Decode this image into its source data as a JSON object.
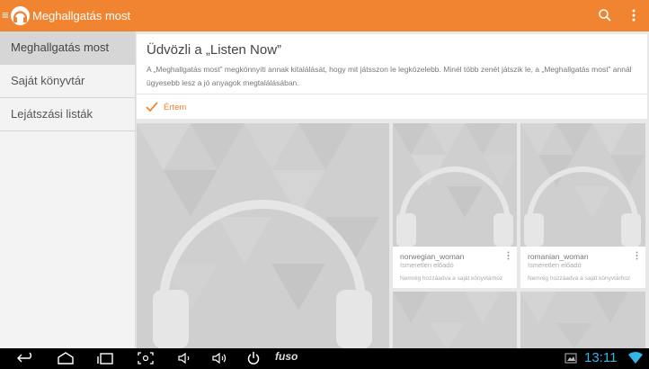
{
  "appbar": {
    "title": "Meghallgatás most"
  },
  "sidebar": {
    "items": [
      {
        "label": "Meghallgatás most",
        "active": true
      },
      {
        "label": "Saját könyvtár",
        "active": false
      },
      {
        "label": "Lejátszási listák",
        "active": false
      }
    ]
  },
  "welcome": {
    "title": "Üdvözli a „Listen Now”",
    "text": "A „Meghallgatás most” megkönnyíti annak kitalálását, hogy mit játsszon le legközelebb. Minél több zenét játszik le, a „Meghallgatás most” annál ügyesebb lesz a jó anyagok megtalálásában.",
    "ok_label": "Értem"
  },
  "cards": [
    {
      "song": "norwegian_woman",
      "artist": "Ismeretlen előadó",
      "added": "Nemrég hozzáadva a saját könyvtárhoz"
    },
    {
      "song": "romanian_woman",
      "artist": "Ismeretlen előadó",
      "added": "Nemrég hozzáadva a saját könyvtárhoz"
    }
  ],
  "statusbar": {
    "brand": "fuso",
    "time": "13:11"
  },
  "colors": {
    "accent": "#f08431",
    "status_blue": "#33b5e5",
    "tile_bg": "#cfcfcf"
  }
}
